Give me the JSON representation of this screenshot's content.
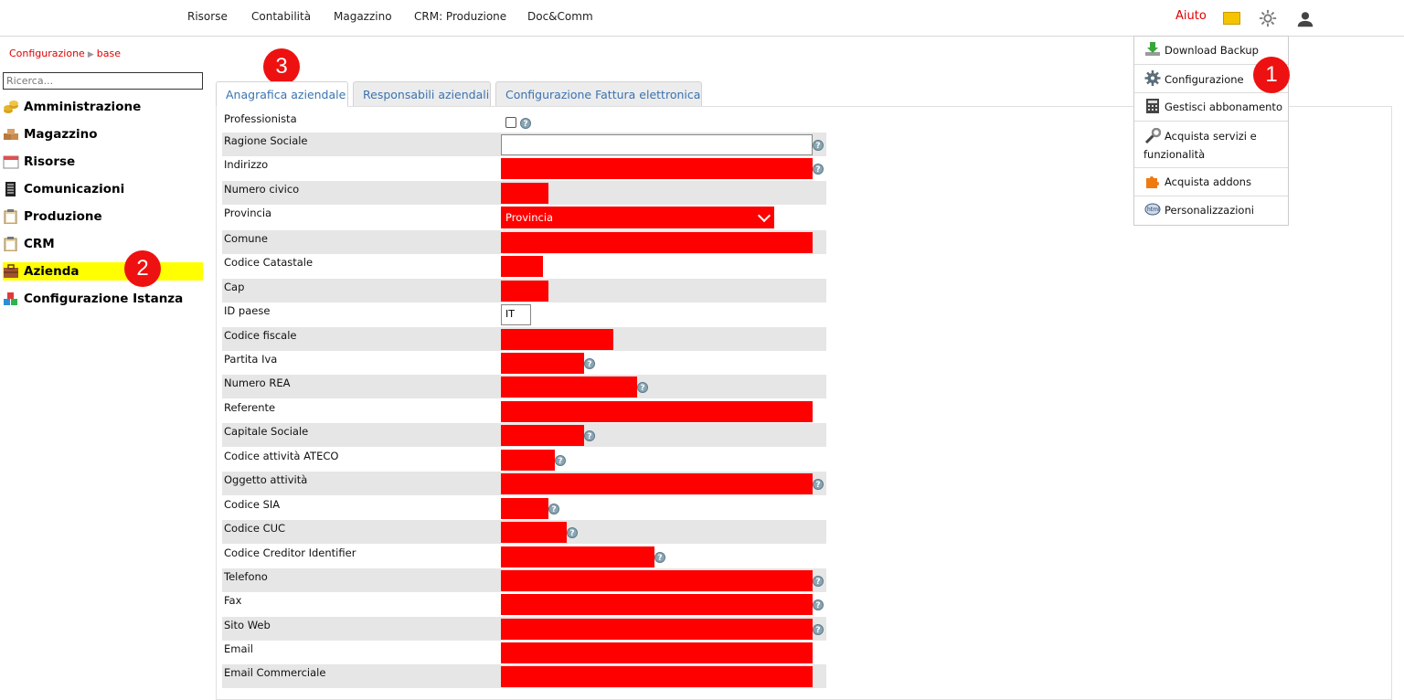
{
  "topnav": {
    "items": [
      "Risorse",
      "Contabilità",
      "Magazzino",
      "CRM: Produzione",
      "Doc&Comm"
    ],
    "help_label": "Aiuto"
  },
  "breadcrumb": {
    "first": "Configurazione",
    "second": "base"
  },
  "sidebar": {
    "search_placeholder": "Ricerca...",
    "items": [
      {
        "label": "Amministrazione",
        "icon": "coins-icon"
      },
      {
        "label": "Magazzino",
        "icon": "boxes-icon"
      },
      {
        "label": "Risorse",
        "icon": "calendar-icon"
      },
      {
        "label": "Comunicazioni",
        "icon": "document-icon"
      },
      {
        "label": "Produzione",
        "icon": "clipboard-icon"
      },
      {
        "label": "CRM",
        "icon": "clipboard-icon"
      },
      {
        "label": "Azienda",
        "icon": "briefcase-icon"
      },
      {
        "label": "Configurazione Istanza",
        "icon": "blocks-icon"
      }
    ]
  },
  "badges": [
    "1",
    "2",
    "3"
  ],
  "tabs": [
    {
      "label": "Anagrafica aziendale",
      "active": true
    },
    {
      "label": "Responsabili aziendali",
      "active": false
    },
    {
      "label": "Configurazione Fattura elettronica",
      "active": false
    }
  ],
  "form": {
    "labels": {
      "professionista": "Professionista",
      "ragione_sociale": "Ragione Sociale",
      "indirizzo": "Indirizzo",
      "numero_civico": "Numero civico",
      "provincia": "Provincia",
      "comune": "Comune",
      "codice_catastale": "Codice Catastale",
      "cap": "Cap",
      "id_paese": "ID paese",
      "codice_fiscale": "Codice fiscale",
      "partita_iva": "Partita Iva",
      "numero_rea": "Numero REA",
      "referente": "Referente",
      "capitale_sociale": "Capitale Sociale",
      "codice_ateco": "Codice attività ATECO",
      "oggetto_attivita": "Oggetto attività",
      "codice_sia": "Codice SIA",
      "codice_cuc": "Codice CUC",
      "codice_creditor": "Codice Creditor Identifier",
      "telefono": "Telefono",
      "fax": "Fax",
      "sito_web": "Sito Web",
      "email": "Email",
      "email_commerciale": "Email Commerciale"
    },
    "provincia_value": "Provincia",
    "id_paese_value": "IT",
    "help_glyph": "?"
  },
  "menu": {
    "items": [
      {
        "label": "Download Backup",
        "icon": "download-icon"
      },
      {
        "label": "Configurazione",
        "icon": "gear-icon"
      },
      {
        "label": "Gestisci abbonamento",
        "icon": "calculator-icon"
      },
      {
        "label": "Acquista servizi e",
        "label2": "funzionalità",
        "icon": "wrench-icon"
      },
      {
        "label": "Acquista addons",
        "icon": "puzzle-icon"
      },
      {
        "label": "Personalizzazioni",
        "icon": "html-icon"
      }
    ]
  },
  "colors": {
    "accent_red": "#ff0000",
    "badge_red": "#ee1111",
    "link_blue": "#3a73b0",
    "highlight": "#ffff00"
  }
}
